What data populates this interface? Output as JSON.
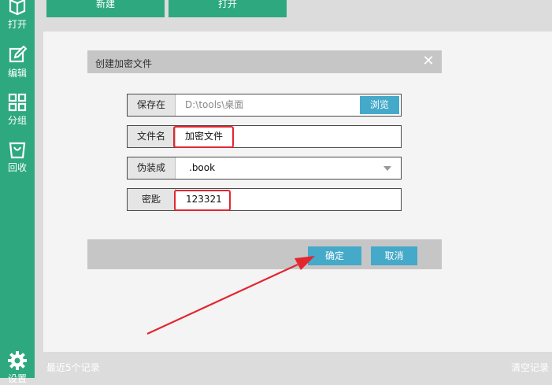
{
  "sidebar": {
    "items": [
      {
        "label": "打开",
        "icon": "box-open-icon"
      },
      {
        "label": "编辑",
        "icon": "edit-icon"
      },
      {
        "label": "分组",
        "icon": "grid-icon"
      },
      {
        "label": "回收",
        "icon": "trash-bag-icon"
      }
    ],
    "settings": {
      "label": "设置",
      "icon": "gear-icon"
    }
  },
  "toolbar": {
    "new_label": "新建",
    "open_label": "打开"
  },
  "dialog": {
    "title": "创建加密文件",
    "close_icon": "close-icon",
    "fields": {
      "save_in": {
        "label": "保存在",
        "value": "D:\\tools\\桌面",
        "browse_label": "浏览"
      },
      "filename": {
        "label": "文件名",
        "value": "加密文件"
      },
      "disguise": {
        "label": "伪装成",
        "value": ".book"
      },
      "key": {
        "label": "密匙",
        "value": "123321"
      }
    },
    "ok_label": "确定",
    "cancel_label": "取消"
  },
  "status": {
    "recent": "最近5个记录",
    "clear": "清空记录"
  },
  "colors": {
    "sidebar": "#2ea97f",
    "accent_button": "#45a9c9",
    "highlight": "#e3262f"
  }
}
